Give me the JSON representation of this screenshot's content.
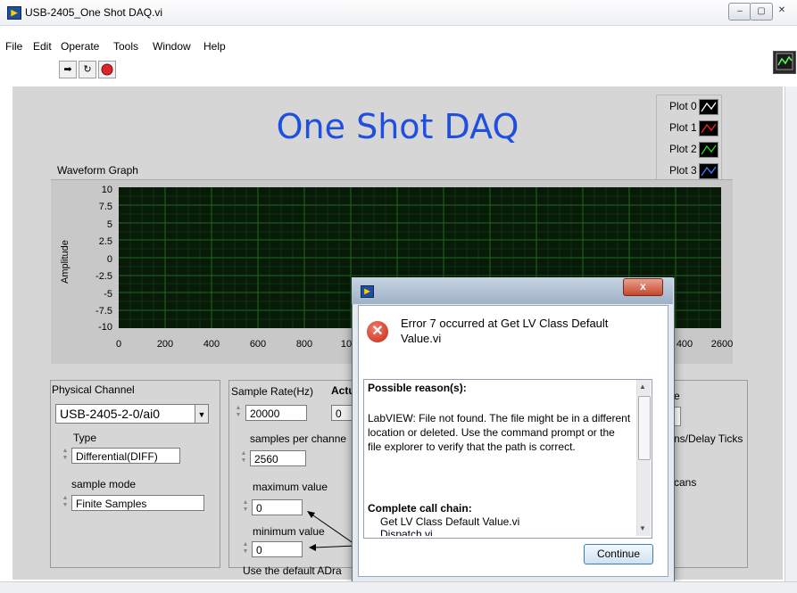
{
  "window": {
    "title": "USB-2405_One Shot DAQ.vi",
    "minimize": "–",
    "maximize": "▢",
    "close": "✕"
  },
  "menu": [
    "File",
    "Edit",
    "Operate",
    "Tools",
    "Window",
    "Help"
  ],
  "toolbar": {
    "run_icon": "run-arrow-icon",
    "continuous_icon": "run-continuously-icon",
    "abort_icon": "abort-icon"
  },
  "panel": {
    "title": "One Shot DAQ",
    "graph_label": "Waveform Graph",
    "y_axis_label": "Amplitude",
    "y_ticks": [
      "10",
      "7.5",
      "5",
      "2.5",
      "0",
      "-2.5",
      "-5",
      "-7.5",
      "-10"
    ],
    "x_ticks": [
      "0",
      "200",
      "400",
      "600",
      "800",
      "10",
      "400",
      "2600"
    ],
    "legend": [
      {
        "label": "Plot 0",
        "color": "#ffffff"
      },
      {
        "label": "Plot 1",
        "color": "#ff2020"
      },
      {
        "label": "Plot 2",
        "color": "#20e020"
      },
      {
        "label": "Plot 3",
        "color": "#3a7fff"
      }
    ],
    "plot_background": "#081a08",
    "grid_color": "#1f6b1f"
  },
  "physical": {
    "label": "Physical Channel",
    "channel": "USB-2405-2-0/ai0",
    "type_label": "Type",
    "type_value": "Differential(DIFF)",
    "mode_label": "sample mode",
    "mode_value": "Finite Samples"
  },
  "timing": {
    "rate_label": "Sample Rate(Hz)",
    "rate_value": "20000",
    "actual_label": "Actu",
    "actual_value": "0",
    "spc_label": "samples per channe",
    "spc_value": "2560",
    "max_label": "maximum value",
    "max_value": "0",
    "min_label": "minimum value",
    "min_value": "0",
    "default_text": "Use the default ADra"
  },
  "right_box": {
    "frag1": "e",
    "frag2": "ns/Delay Ticks",
    "frag3": "cans"
  },
  "dialog": {
    "error_title": "Error 7 occurred at Get LV Class Default Value.vi",
    "possible_reasons": "Possible reason(s):",
    "reason_text": "LabVIEW:  File not found. The file might be in a different location or deleted. Use the command prompt or the file explorer to verify that the path is correct.",
    "call_chain_label": "Complete call chain:",
    "call_chain_1": "Get LV Class Default Value.vi",
    "call_chain_2": "Dispatch.vi",
    "continue_label": "Continue",
    "close_label": "x"
  }
}
